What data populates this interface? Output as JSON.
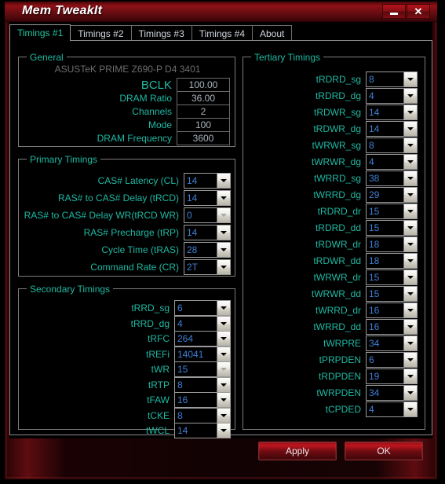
{
  "window": {
    "title": "Mem TweakIt",
    "minimize_label": "–",
    "close_label": "✕"
  },
  "tabs": [
    {
      "label": "Timings #1",
      "active": true
    },
    {
      "label": "Timings #2",
      "active": false
    },
    {
      "label": "Timings #3",
      "active": false
    },
    {
      "label": "Timings #4",
      "active": false
    },
    {
      "label": "About",
      "active": false
    }
  ],
  "general": {
    "title": "General",
    "motherboard": "ASUSTeK PRIME Z690-P D4 3401",
    "rows": [
      {
        "label": "BCLK",
        "value": "100.00"
      },
      {
        "label": "DRAM Ratio",
        "value": "36.00"
      },
      {
        "label": "Channels",
        "value": "2"
      },
      {
        "label": "Mode",
        "value": "100"
      },
      {
        "label": "DRAM Frequency",
        "value": "3600"
      }
    ]
  },
  "primary": {
    "title": "Primary Timings",
    "rows": [
      {
        "label": "CAS# Latency (CL)",
        "value": "14",
        "enabled": true
      },
      {
        "label": "RAS# to CAS# Delay (tRCD)",
        "value": "14",
        "enabled": true
      },
      {
        "label": "RAS# to CAS# Delay WR(tRCD WR)",
        "value": "0",
        "enabled": false
      },
      {
        "label": "RAS# Precharge (tRP)",
        "value": "14",
        "enabled": true
      },
      {
        "label": "Cycle Time (tRAS)",
        "value": "28",
        "enabled": true
      },
      {
        "label": "Command Rate (CR)",
        "value": "2T",
        "enabled": true
      }
    ]
  },
  "secondary": {
    "title": "Secondary Timings",
    "rows": [
      {
        "label": "tRRD_sg",
        "value": "6",
        "enabled": true
      },
      {
        "label": "tRRD_dg",
        "value": "4",
        "enabled": true
      },
      {
        "label": "tRFC",
        "value": "264",
        "enabled": true
      },
      {
        "label": "tREFi",
        "value": "14041",
        "enabled": true
      },
      {
        "label": "tWR",
        "value": "15",
        "enabled": false
      },
      {
        "label": "tRTP",
        "value": "8",
        "enabled": true
      },
      {
        "label": "tFAW",
        "value": "16",
        "enabled": true
      },
      {
        "label": "tCKE",
        "value": "8",
        "enabled": true
      },
      {
        "label": "tWCL",
        "value": "14",
        "enabled": true
      }
    ]
  },
  "tertiary": {
    "title": "Tertiary Timings",
    "rows": [
      {
        "label": "tRDRD_sg",
        "value": "8",
        "enabled": true
      },
      {
        "label": "tRDRD_dg",
        "value": "4",
        "enabled": true
      },
      {
        "label": "tRDWR_sg",
        "value": "14",
        "enabled": true
      },
      {
        "label": "tRDWR_dg",
        "value": "14",
        "enabled": true
      },
      {
        "label": "tWRWR_sg",
        "value": "8",
        "enabled": true
      },
      {
        "label": "tWRWR_dg",
        "value": "4",
        "enabled": true
      },
      {
        "label": "tWRRD_sg",
        "value": "38",
        "enabled": true
      },
      {
        "label": "tWRRD_dg",
        "value": "29",
        "enabled": true
      },
      {
        "label": "tRDRD_dr",
        "value": "15",
        "enabled": true
      },
      {
        "label": "tRDRD_dd",
        "value": "15",
        "enabled": true
      },
      {
        "label": "tRDWR_dr",
        "value": "18",
        "enabled": true
      },
      {
        "label": "tRDWR_dd",
        "value": "18",
        "enabled": true
      },
      {
        "label": "tWRWR_dr",
        "value": "15",
        "enabled": true
      },
      {
        "label": "tWRWR_dd",
        "value": "15",
        "enabled": true
      },
      {
        "label": "tWRRD_dr",
        "value": "16",
        "enabled": true
      },
      {
        "label": "tWRRD_dd",
        "value": "16",
        "enabled": true
      },
      {
        "label": "tWRPRE",
        "value": "34",
        "enabled": true
      },
      {
        "label": "tPRPDEN",
        "value": "6",
        "enabled": true
      },
      {
        "label": "tRDPDEN",
        "value": "19",
        "enabled": true
      },
      {
        "label": "tWRPDEN",
        "value": "34",
        "enabled": true
      },
      {
        "label": "tCPDED",
        "value": "4",
        "enabled": true
      }
    ]
  },
  "buttons": {
    "apply": "Apply",
    "ok": "OK"
  },
  "colors": {
    "accent_red": "#8e1117",
    "label_teal": "#1fb8a2",
    "value_blue": "#3f7fd6",
    "readonly_grey": "#a9b4bd"
  }
}
